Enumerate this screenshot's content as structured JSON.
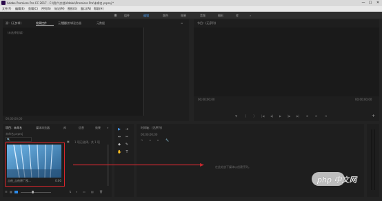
{
  "app": {
    "title": "Adobe Premiere Pro CC 2017 - C:\\用户\\文档\\Adobe\\Premiere Pro\\未命名.prproj *",
    "window_buttons": [
      "—",
      "□",
      "✕"
    ]
  },
  "menu": [
    "文件(F)",
    "编辑(E)",
    "剪辑(C)",
    "序列(S)",
    "标记(M)",
    "图形(G)",
    "窗口(W)",
    "帮助(H)"
  ],
  "workspaces": [
    "组件",
    "编辑",
    "颜色",
    "效果",
    "音频",
    "图形",
    "库"
  ],
  "source_panel": {
    "tabs": [
      "源：(无剪辑)",
      "效果控件",
      "音频剪辑混合器",
      "元数据"
    ],
    "active_tab": 1,
    "menu_icon": "≡",
    "empty_text": "（未选择剪辑）",
    "timecode": "00;00;00;00"
  },
  "program_monitor": {
    "tab": "节目：(无序列)",
    "timecode_left": "00;00;00;00",
    "timecode_right": "00;00;00;00",
    "controls": [
      "▼",
      "{",
      "}",
      "|◀",
      "◀|",
      "▶",
      "|▶",
      "▶|",
      "⊞",
      "⊟",
      "⊡"
    ],
    "add_button": "+"
  },
  "project_panel": {
    "tabs": [
      "项目：未命名",
      "媒体浏览器",
      "库",
      "信息",
      "效果"
    ],
    "active_tab": 0,
    "more": "»",
    "project_file": "未命名.prproj",
    "selection_info": "1 项已选择，共 1 项",
    "clip_caption": "吉他_吉他原厂视...",
    "clip_duration": "0:00",
    "search_placeholder": "🔍"
  },
  "tools": [
    "▶",
    "⇥",
    "⇔",
    "⇿",
    "◆",
    "✎",
    "✋",
    "T"
  ],
  "timeline": {
    "tab": "时间轴：(无序列)",
    "timecode": "00;00;00;00",
    "drop_hint": "在此处放下媒体以创建序列。"
  },
  "watermark": "php 中文网",
  "colors": {
    "accent": "#2d8ceb",
    "highlight_box": "#d9262c",
    "arrow": "#c0282e"
  }
}
